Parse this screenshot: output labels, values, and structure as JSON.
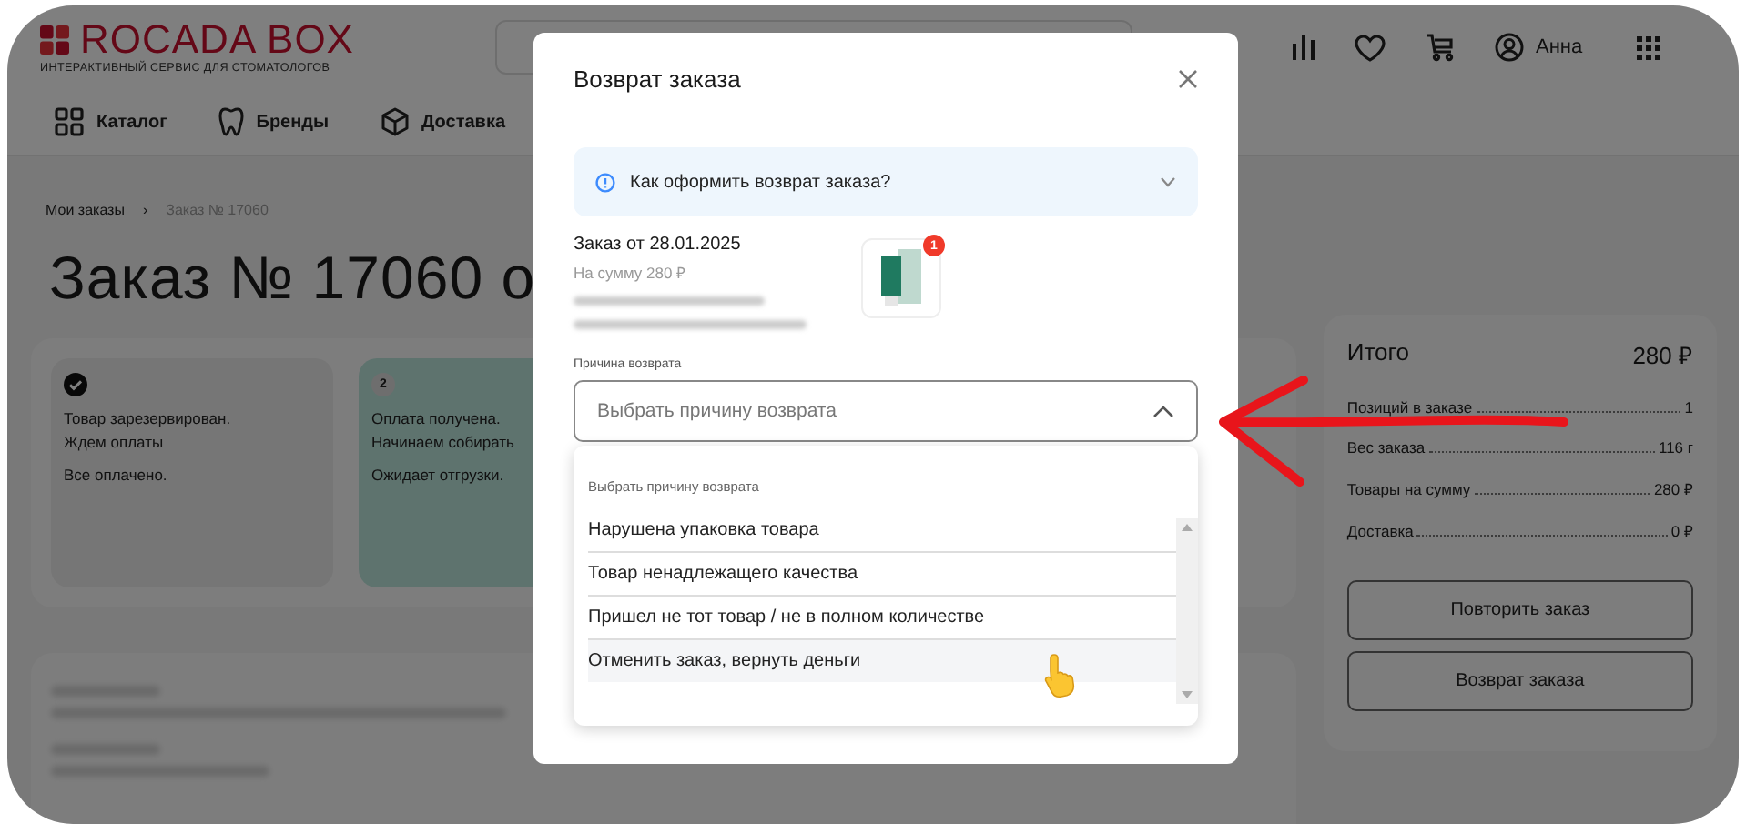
{
  "logo": {
    "name": "ROCADA BOX",
    "tagline": "ИНТЕРАКТИВНЫЙ СЕРВИС ДЛЯ СТОМАТОЛОГОВ"
  },
  "header": {
    "user": "Анна"
  },
  "nav": [
    {
      "label": "Каталог",
      "kind": "grid"
    },
    {
      "label": "Бренды",
      "kind": "tooth"
    },
    {
      "label": "Доставка",
      "kind": "box"
    }
  ],
  "breadcrumbs": [
    "Мои заказы",
    "›",
    "Заказ № 17060"
  ],
  "page_title": "Заказ № 17060 о",
  "status_steps": [
    {
      "kind": "done",
      "lines": [
        "Товар зарезервирован.",
        "Ждем оплаты"
      ],
      "note": "Все оплачено.",
      "selected": false
    },
    {
      "kind": "number",
      "number": "2",
      "lines": [
        "Оплата получена.",
        "Начинаем собирать"
      ],
      "note": "Ожидает отгрузки.",
      "selected": true
    }
  ],
  "summary": {
    "title": "Итого",
    "total": "280 ₽",
    "rows": [
      {
        "label": "Позиций в заказе",
        "value": "1"
      },
      {
        "label": "Вес заказа",
        "value": "116 г"
      },
      {
        "label": "Товары на сумму",
        "value": "280 ₽"
      },
      {
        "label": "Доставка",
        "value": "0 ₽"
      }
    ],
    "buttons": [
      "Повторить заказ",
      "Возврат заказа"
    ]
  },
  "modal": {
    "title": "Возврат заказа",
    "help": {
      "label": "Как оформить возврат заказа?",
      "expanded": false
    },
    "order": {
      "title": "Заказ от 28.01.2025",
      "sum": "На сумму 280 ₽",
      "item_count": "1"
    },
    "reason": {
      "label": "Причина возврата",
      "placeholder": "Выбрать причину возврата",
      "expanded": true,
      "header": "Выбрать причину возврата",
      "options": [
        {
          "label": "Нарушена упаковка товара",
          "hovered": false
        },
        {
          "label": "Товар ненадлежащего качества",
          "hovered": false
        },
        {
          "label": "Пришел не тот товар / не в полном количестве",
          "hovered": false
        },
        {
          "label": "Отменить заказ, вернуть деньги",
          "hovered": true
        }
      ]
    }
  }
}
